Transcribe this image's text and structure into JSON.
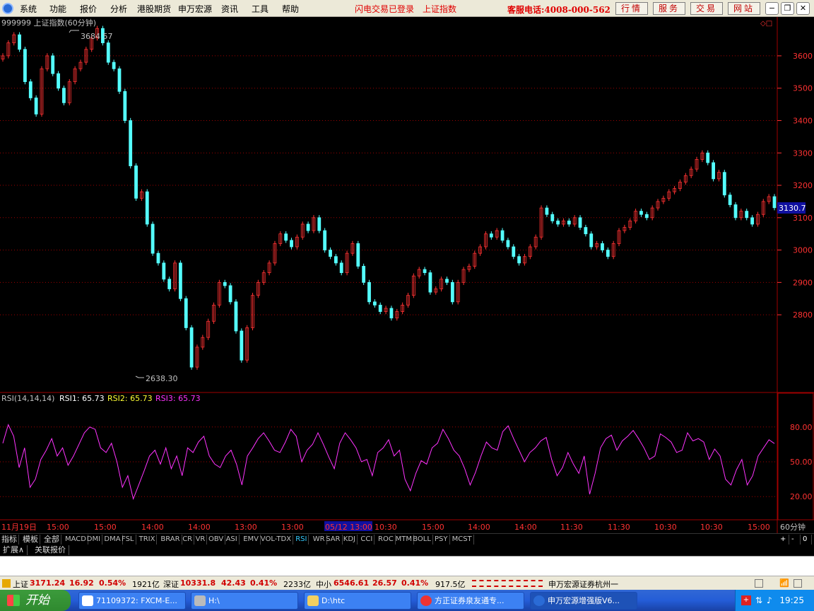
{
  "menu": {
    "items": [
      "系统",
      "功能",
      "报价",
      "分析",
      "港股期货",
      "申万宏源",
      "资讯",
      "工具",
      "帮助"
    ],
    "login_status": "闪电交易已登录",
    "index_name": "上证指数",
    "hotline": "客服电话:4008-000-562",
    "top_buttons": [
      "行情",
      "服务",
      "交易",
      "网站"
    ]
  },
  "chart_data": [
    {
      "type": "line",
      "title": "999999 上证指数(60分钟)",
      "ylim": [
        2560,
        3720
      ],
      "yticks": [
        2800,
        2900,
        3000,
        3100,
        3200,
        3300,
        3400,
        3500,
        3600
      ],
      "annotations": {
        "high": "3684.57",
        "low": "2638.30",
        "current": "3130.7"
      },
      "series": [
        {
          "values": [
            3600,
            3640,
            3665,
            3620,
            3520,
            3470,
            3420,
            3560,
            3600,
            3545,
            3500,
            3455,
            3520,
            3560,
            3580,
            3620,
            3655,
            3684.57,
            3640,
            3580,
            3560,
            3490,
            3400,
            3260,
            3160,
            3180,
            3080,
            2990,
            2960,
            2910,
            2880,
            2960,
            2850,
            2760,
            2638.3,
            2700,
            2730,
            2780,
            2830,
            2900,
            2890,
            2840,
            2750,
            2660,
            2760,
            2860,
            2900,
            2930,
            2960,
            3020,
            3050,
            3030,
            3010,
            3040,
            3080,
            3060,
            3100,
            3060,
            3000,
            2980,
            2960,
            2930,
            2990,
            3020,
            2950,
            2900,
            2840,
            2830,
            2810,
            2820,
            2790,
            2810,
            2830,
            2860,
            2920,
            2940,
            2930,
            2870,
            2880,
            2910,
            2900,
            2840,
            2900,
            2940,
            2950,
            2990,
            3010,
            3050,
            3040,
            3060,
            3030,
            3010,
            2980,
            2960,
            2980,
            3010,
            3040,
            3130,
            3110,
            3090,
            3080,
            3090,
            3080,
            3100,
            3070,
            3050,
            3010,
            3020,
            3000,
            2980,
            3020,
            3060,
            3070,
            3090,
            3120,
            3110,
            3100,
            3130,
            3150,
            3160,
            3180,
            3190,
            3210,
            3230,
            3250,
            3280,
            3300,
            3270,
            3220,
            3240,
            3170,
            3140,
            3100,
            3120,
            3100,
            3080,
            3110,
            3150,
            3165,
            3130.7
          ]
        }
      ]
    },
    {
      "type": "line",
      "title": "RSI(14,14,14)",
      "ylim": [
        0,
        100
      ],
      "yticks": [
        20,
        50,
        80
      ],
      "series": [
        {
          "name": "RSI1",
          "value_label": "RSI1: 65.73",
          "color": "#ffffff"
        },
        {
          "name": "RSI2",
          "value_label": "RSI2: 65.73",
          "color": "#ffff33"
        },
        {
          "name": "RSI3",
          "value_label": "RSI3: 65.73",
          "color": "#ff33ff",
          "values": [
            66,
            82,
            72,
            45,
            62,
            28,
            35,
            52,
            60,
            70,
            55,
            62,
            47,
            55,
            65,
            75,
            80,
            78,
            62,
            58,
            66,
            50,
            28,
            38,
            18,
            30,
            42,
            55,
            60,
            48,
            62,
            44,
            55,
            38,
            62,
            58,
            67,
            72,
            55,
            48,
            45,
            55,
            60,
            48,
            30,
            55,
            62,
            70,
            75,
            68,
            60,
            58,
            67,
            78,
            72,
            50,
            60,
            65,
            75,
            65,
            54,
            44,
            66,
            75,
            69,
            62,
            50,
            52,
            38,
            58,
            62,
            69,
            55,
            60,
            35,
            25,
            40,
            51,
            48,
            62,
            66,
            78,
            70,
            60,
            55,
            44,
            30,
            41,
            55,
            67,
            62,
            60,
            76,
            81,
            70,
            60,
            50,
            58,
            62,
            68,
            71,
            52,
            38,
            45,
            58,
            48,
            40,
            55,
            22,
            40,
            62,
            70,
            73,
            60,
            68,
            72,
            77,
            70,
            62,
            52,
            55,
            74,
            71,
            67,
            58,
            60,
            75,
            68,
            70,
            67,
            52,
            61,
            55,
            35,
            30,
            43,
            52,
            30,
            38,
            55,
            62,
            69,
            65.73
          ]
        }
      ]
    }
  ],
  "dates": [
    "11月19日",
    "15:00",
    "15:00",
    "14:00",
    "14:00",
    "13:00",
    "13:00",
    "05/12 13:00",
    "10:30",
    "15:00",
    "14:00",
    "14:00",
    "11:30",
    "11:30",
    "10:30",
    "10:30",
    "15:00"
  ],
  "period_label": "60分钟",
  "indicators": [
    "指标",
    "模板",
    "全部",
    "MACD",
    "DMI",
    "DMA",
    "FSL",
    "TRIX",
    "BRAR",
    "CR",
    "VR",
    "OBV",
    "ASI",
    "EMV",
    "VOL-TDX",
    "RSI",
    "WR",
    "SAR",
    "KDJ",
    "CCI",
    "ROC",
    "MTM",
    "BOLL",
    "PSY",
    "MCST"
  ],
  "zoom_buttons": [
    "+",
    "-",
    "0"
  ],
  "ext_tabs": [
    "扩展∧",
    "关联报价"
  ],
  "status": {
    "sh_name": "上证",
    "sh_value": "3171.24",
    "sh_change": "16.92",
    "sh_pct": "0.54%",
    "sh_vol": "1921亿",
    "sz_name": "深证",
    "sz_value": "10331.8",
    "sz_change": "42.43",
    "sz_pct": "0.41%",
    "sz_vol": "2233亿",
    "zx_name": "中小",
    "zx_value": "6546.61",
    "zx_change": "26.57",
    "zx_pct": "0.41%",
    "zx_vol": "917.5亿",
    "broker": "申万宏源证券杭州一"
  },
  "taskbar": {
    "start": "开始",
    "tasks": [
      "71109372: FXCM-E...",
      "H:\\",
      "D:\\htc",
      "方正证券泉友通专...",
      "申万宏源增强版V6..."
    ],
    "clock": "19:25"
  },
  "colors": {
    "up": "#ff3232",
    "down": "#54ffff",
    "grid": "#a00000",
    "rsi": "#ff33ff",
    "axis": "#ff3232"
  }
}
